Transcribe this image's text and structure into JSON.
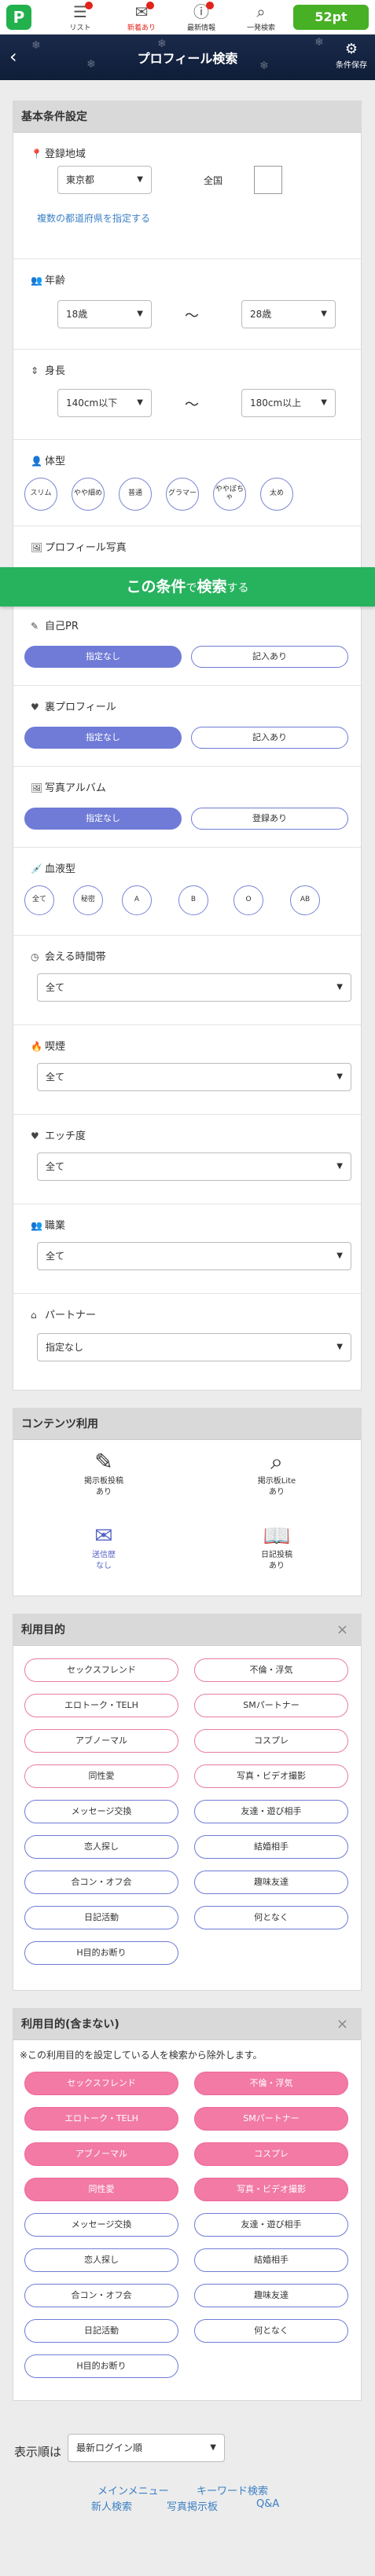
{
  "topnav": {
    "logo": "P",
    "items": [
      {
        "label": "リスト",
        "icon": "list-icon"
      },
      {
        "label": "新着あり",
        "icon": "mail-icon"
      },
      {
        "label": "最新情報",
        "icon": "info-icon"
      },
      {
        "label": "一発検索",
        "icon": "search-icon"
      }
    ],
    "points": "52pt"
  },
  "header": {
    "title": "プロフィール検索",
    "back": "‹",
    "save": "条件保存"
  },
  "basic": {
    "title": "基本条件設定",
    "region": {
      "label": "登録地域",
      "value": "東京都",
      "nationwide": "全国",
      "link": "複数の都道府県を指定する"
    },
    "age": {
      "label": "年齢",
      "from": "18歳",
      "to": "28歳"
    },
    "height": {
      "label": "身長",
      "from": "140cm以下",
      "to": "180cm以上"
    },
    "body": {
      "label": "体型",
      "options": [
        "スリム",
        "やや細め",
        "普通",
        "グラマー",
        "ややぽちゃ",
        "太め"
      ]
    },
    "photo": {
      "label": "プロフィール写真"
    },
    "pr": {
      "label": "自己PR",
      "options": [
        "指定なし",
        "記入あり"
      ]
    },
    "ura": {
      "label": "裏プロフィール",
      "options": [
        "指定なし",
        "記入あり"
      ]
    },
    "album": {
      "label": "写真アルバム",
      "options": [
        "指定なし",
        "登録あり"
      ]
    },
    "blood": {
      "label": "血液型",
      "options": [
        "全て",
        "秘密",
        "A",
        "B",
        "O",
        "AB"
      ]
    },
    "meet_time": {
      "label": "会える時間帯",
      "value": "全て"
    },
    "smoking": {
      "label": "喫煙",
      "value": "全て"
    },
    "ecchi": {
      "label": "エッチ度",
      "value": "全て"
    },
    "job": {
      "label": "職業",
      "value": "全て"
    },
    "partner": {
      "label": "パートナー",
      "value": "指定なし"
    },
    "tilde": "〜"
  },
  "banner": {
    "main": "この条件",
    "mid": "で",
    "search": "検索",
    "suffix": "する"
  },
  "contents": {
    "title": "コンテンツ利用",
    "items": [
      {
        "l1": "掲示板投稿",
        "l2": "あり"
      },
      {
        "l1": "掲示板Lite",
        "l2": "あり"
      },
      {
        "l1": "送信歴",
        "l2": "なし"
      },
      {
        "l1": "日記投稿",
        "l2": "あり"
      }
    ]
  },
  "purpose": {
    "title": "利用目的",
    "close": "×",
    "items": [
      "セックスフレンド",
      "不倫・浮気",
      "エロトーク・TELH",
      "SMパートナー",
      "アブノーマル",
      "コスプレ",
      "同性愛",
      "写真・ビデオ撮影",
      "メッセージ交換",
      "友達・遊び相手",
      "恋人探し",
      "結婚相手",
      "合コン・オフ会",
      "趣味友達",
      "日記活動",
      "何となく",
      "H目的お断り"
    ]
  },
  "exclude": {
    "title": "利用目的(含まない)",
    "close": "×",
    "note": "※この利用目的を設定している人を検索から除外します。",
    "items": [
      "セックスフレンド",
      "不倫・浮気",
      "エロトーク・TELH",
      "SMパートナー",
      "アブノーマル",
      "コスプレ",
      "同性愛",
      "写真・ビデオ撮影",
      "メッセージ交換",
      "友達・遊び相手",
      "恋人探し",
      "結婚相手",
      "合コン・オフ会",
      "趣味友達",
      "日記活動",
      "何となく",
      "H目的お断り"
    ]
  },
  "sort": {
    "label": "表示順は",
    "value": "最新ログイン順"
  },
  "footer_links": [
    "メインメニュー",
    "キーワード検索",
    "新人検索",
    "写真掲示板",
    "Q&A"
  ],
  "colors": {
    "green": "#27b25e",
    "accent": "#6f7bd6",
    "pink": "#f27aa5"
  }
}
